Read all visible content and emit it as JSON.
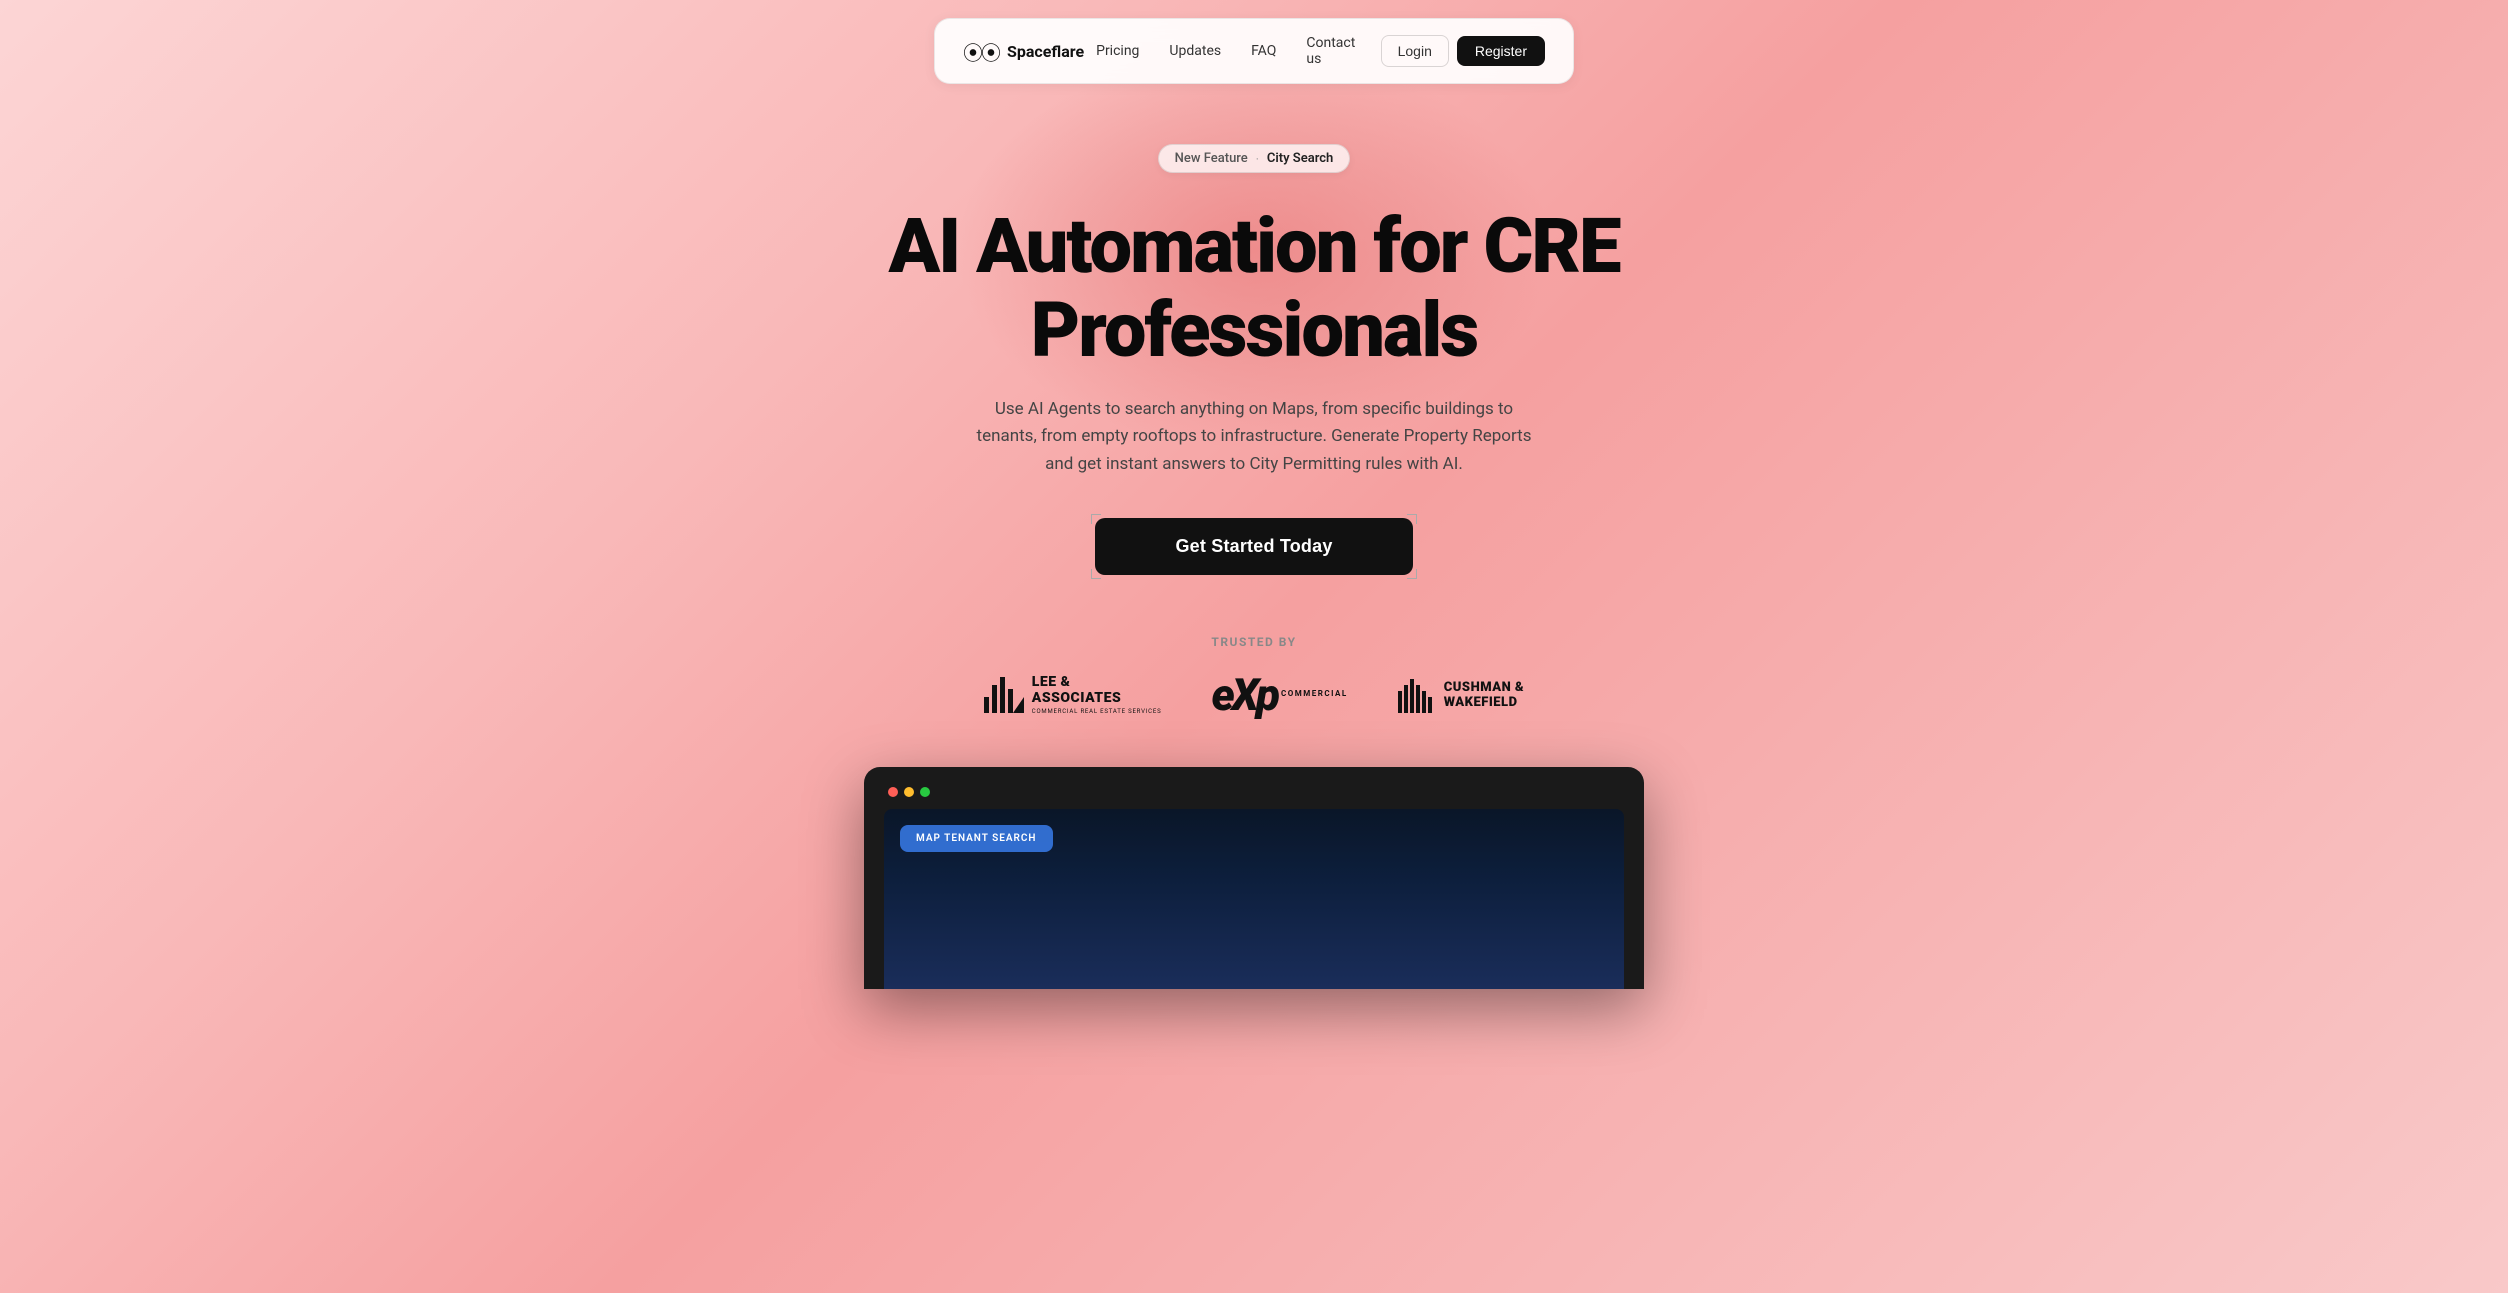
{
  "brand": {
    "logo_symbol": "(((",
    "name": "Spaceflare"
  },
  "nav": {
    "links": [
      {
        "label": "Pricing",
        "id": "pricing"
      },
      {
        "label": "Updates",
        "id": "updates"
      },
      {
        "label": "FAQ",
        "id": "faq"
      },
      {
        "label": "Contact us",
        "id": "contact"
      }
    ],
    "login_label": "Login",
    "register_label": "Register"
  },
  "feature_badge": {
    "label": "New Feature",
    "separator": "·",
    "value": "City Search"
  },
  "hero": {
    "heading_line1": "AI Automation for CRE",
    "heading_line2": "Professionals",
    "subtext": "Use AI Agents to search anything on Maps, from specific buildings to tenants, from empty rooftops to infrastructure. Generate Property Reports and get instant answers to City Permitting rules with AI."
  },
  "cta": {
    "label": "Get Started Today"
  },
  "trusted": {
    "label": "TRUSTED BY",
    "logos": [
      {
        "id": "lee",
        "name": "LEE &",
        "name2": "ASSOCIATES",
        "sub": "COMMERCIAL REAL ESTATE SERVICES"
      },
      {
        "id": "exp",
        "main": "eXp",
        "sub1": "COMMERCIAL"
      },
      {
        "id": "cushman",
        "name": "CUSHMAN &",
        "name2": "WAKEFIELD"
      }
    ]
  },
  "laptop": {
    "ui_label": "MAP TENANT SEARCH",
    "dot_colors": [
      "#ff5f57",
      "#ffbd2e",
      "#28ca41"
    ]
  }
}
